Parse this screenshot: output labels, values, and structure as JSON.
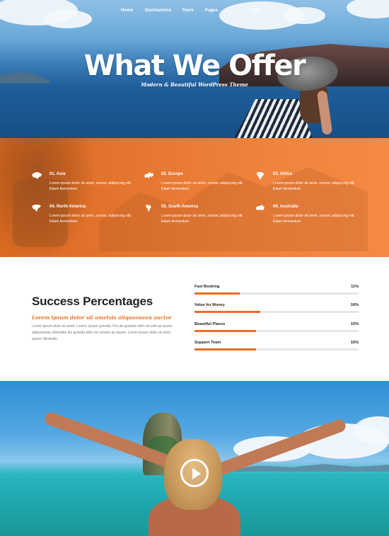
{
  "nav": {
    "items": [
      "Home",
      "Destinations",
      "Tours",
      "Pages",
      "",
      "Elem"
    ]
  },
  "hero": {
    "title": "What We Offer",
    "subtitle": "Modern & Beautiful WordPress Theme"
  },
  "regions": [
    {
      "title": "01. Asia",
      "text": "Lorem ipsum dolor sit amet, consec adipiscing elit. Etiam fermentum",
      "icon": "asia-map-icon"
    },
    {
      "title": "02. Europe",
      "text": "Lorem ipsum dolor sit amet, consec adipiscing elit. Etiam fermentum",
      "icon": "europe-map-icon"
    },
    {
      "title": "03. Africa",
      "text": "Lorem ipsum dolor sit amet, consec adipiscing elit. Etiam fermentum",
      "icon": "africa-map-icon"
    },
    {
      "title": "04. North America",
      "text": "Lorem ipsum dolor sit amet, consec adipiscing elit. Etiam fermentum",
      "icon": "north-america-map-icon"
    },
    {
      "title": "05. South America",
      "text": "Lorem ipsum dolor sit amet, consec adipiscing elit. Etiam fermentum",
      "icon": "south-america-map-icon"
    },
    {
      "title": "06. Australia",
      "text": "Lorem ipsum dolor sit amet, consec adipiscing elit. Etiam fermentum",
      "icon": "australia-map-icon"
    }
  ],
  "success": {
    "title": "Success Percentages",
    "subtitle": "Lorem ipsum dolor sit ametsis aliqueenean auctor",
    "body": "Lorem ipsum dolor sit amet. Lorem. Ipsum gravida. Pro ain gravida nibh vel velit an auctor aliqueenean ollicitudin ain gravida nibh vel version an ipsum. Lorem ipsum dolor sit amet auctor ollicitudin.",
    "bars": [
      {
        "label": "Fast Booking",
        "value": "11%",
        "percent": 11
      },
      {
        "label": "Value for Money",
        "value": "16%",
        "percent": 16
      },
      {
        "label": "Beautiful Places",
        "value": "15%",
        "percent": 15
      },
      {
        "label": "Support Team",
        "value": "15%",
        "percent": 15
      }
    ]
  },
  "colors": {
    "accent": "#ef6b25",
    "orange_section": "#e57630"
  }
}
